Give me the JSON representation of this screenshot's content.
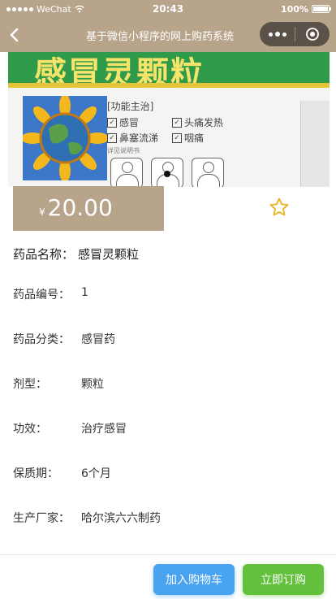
{
  "status_bar": {
    "carrier": "WeChat",
    "time": "20:43",
    "battery": "100%"
  },
  "nav": {
    "title": "基于微信小程序的网上购药系统"
  },
  "product_image": {
    "package_title": "感冒灵颗粒",
    "section_title": "[功能主治]",
    "indications": [
      "感冒",
      "头痛发热",
      "鼻塞流涕",
      "咽痛"
    ],
    "note": "详见说明书"
  },
  "price": {
    "currency": "¥",
    "value": "20.00"
  },
  "product": {
    "name_label": "药品名称：",
    "name_value": "感冒灵颗粒",
    "details": [
      {
        "label": "药品编号：",
        "value": "1"
      },
      {
        "label": "药品分类：",
        "value": "感冒药"
      },
      {
        "label": "剂型：",
        "value": "颗粒"
      },
      {
        "label": "功效：",
        "value": "治疗感冒"
      },
      {
        "label": "保质期：",
        "value": "6个月"
      },
      {
        "label": "生产厂家：",
        "value": "哈尔滨六六制药"
      }
    ]
  },
  "actions": {
    "add_to_cart": "加入购物车",
    "buy_now": "立即订购"
  },
  "colors": {
    "theme": "#b8a48b",
    "cart_button": "#4aa3f0",
    "buy_button": "#63c13d",
    "star": "#e6b422"
  },
  "icons": {
    "back": "chevron-left-icon",
    "more": "more-dots-icon",
    "capsule": "target-icon",
    "favorite": "star-outline-icon"
  }
}
